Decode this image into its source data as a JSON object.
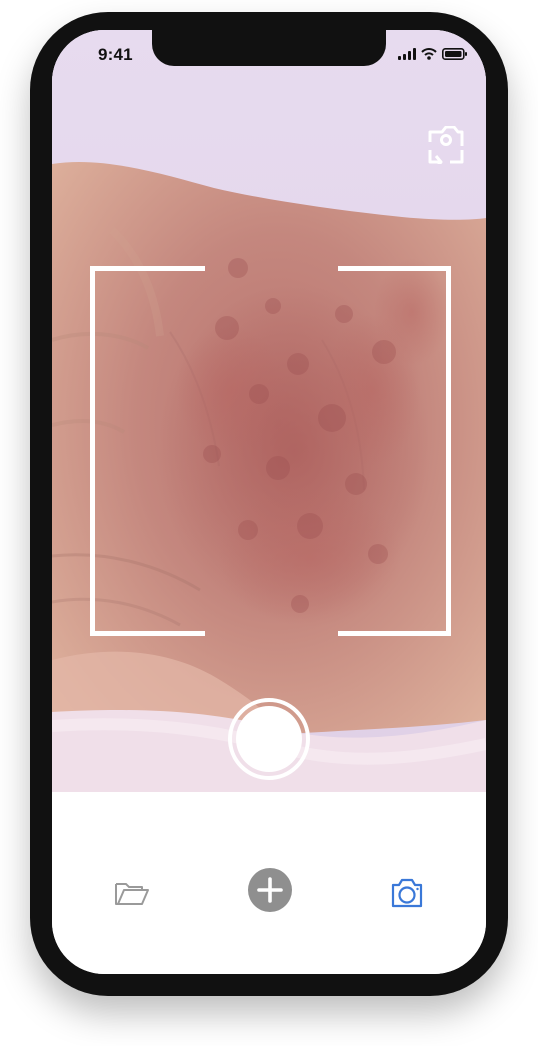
{
  "status_bar": {
    "time": "9:41",
    "signal_icon": "signal-bars-icon",
    "wifi_icon": "wifi-icon",
    "battery_icon": "battery-icon"
  },
  "camera": {
    "switch_icon": "switch-camera-icon",
    "frame_guide": "scan-frame-brackets",
    "shutter_icon": "shutter-icon"
  },
  "tab_bar": {
    "items": [
      {
        "icon": "folder-icon",
        "color": "#9a9a9a"
      },
      {
        "icon": "plus-circle-icon",
        "color": "#8f8f8f"
      },
      {
        "icon": "camera-icon",
        "color": "#3a78d8",
        "selected": true
      }
    ]
  },
  "colors": {
    "phone_frame": "#111111",
    "viewfinder_background": "#e5d8ef",
    "skin_tone": "#c88f81",
    "tab_active": "#3a78d8",
    "tab_inactive": "#9a9a9a"
  }
}
